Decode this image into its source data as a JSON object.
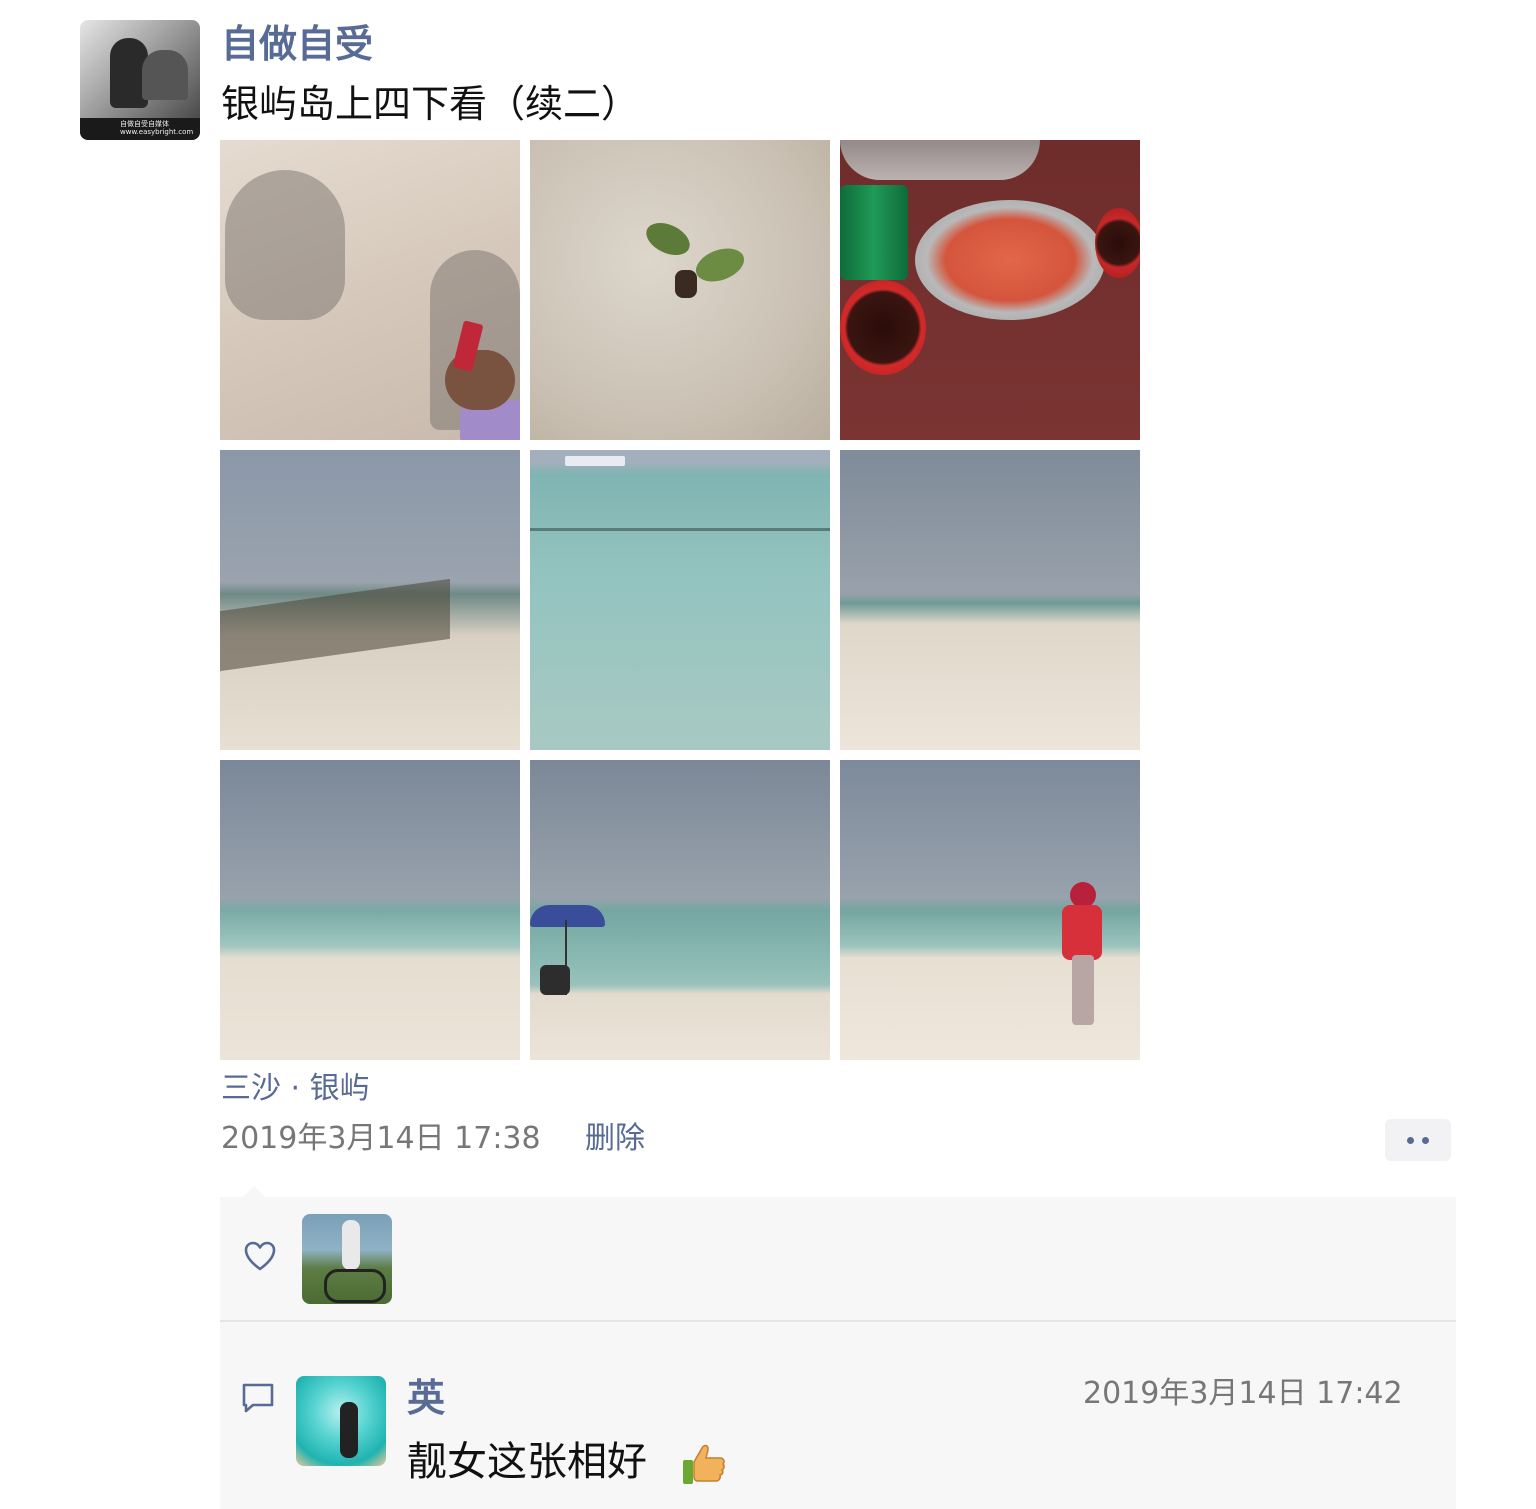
{
  "post": {
    "author": "自做自受",
    "text": "银屿岛上四下看（续二）",
    "avatar_watermark": "自做自受自媒体 www.easybright.com",
    "location": "三沙 · 银屿",
    "timestamp": "2019年3月14日 17:38",
    "delete_label": "删除",
    "photos": [
      "shadows-on-sand",
      "seedling-in-sand",
      "crab-dinner",
      "beach-with-rocks",
      "turquoise-sea",
      "sandbar-beach",
      "beach-horizon",
      "beach-umbrella",
      "woman-on-beach"
    ]
  },
  "likes": {
    "icon": "heart-icon"
  },
  "comments": [
    {
      "name": "英",
      "time": "2019年3月14日 17:42",
      "text": "靓女这张相好",
      "emoji": "thumbs-up-icon"
    }
  ]
}
